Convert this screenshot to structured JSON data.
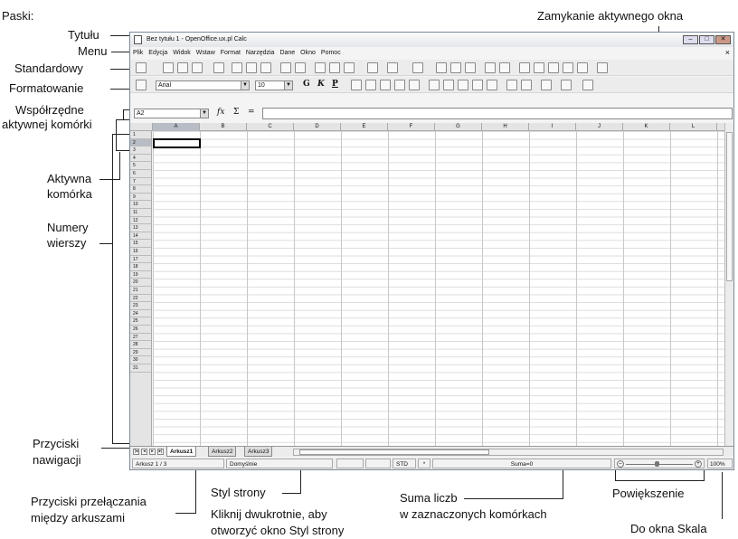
{
  "annotations": {
    "paski": "Paski:",
    "tytulu": "Tytułu",
    "menu": "Menu",
    "standardowy": "Standardowy",
    "formatowanie": "Formatowanie",
    "wspolrzedne_1": "Współrzędne",
    "wspolrzedne_2": "aktywnej komórki",
    "aktywna_1": "Aktywna",
    "aktywna_2": "komórka",
    "numery_1": "Numery",
    "numery_2": "wierszy",
    "nawig_1": "Przyciski",
    "nawig_2": "nawigacji",
    "przel_1": "Przyciski przełączania",
    "przel_2": "między arkuszami",
    "styl_1": "Styl strony",
    "styl_2": "Kliknij dwukrotnie, aby",
    "styl_3": "otworzyć okno Styl strony",
    "suma_1": "Suma liczb",
    "suma_2": "w zaznaczonych komórkach",
    "zamykanie": "Zamykanie aktywnego okna",
    "powiekszenie": "Powiększenie",
    "skala": "Do okna Skala"
  },
  "window": {
    "title": "Bez tytułu 1 - OpenOffice.ux.pl Calc",
    "min_icon": "–",
    "max_icon": "□",
    "close_icon": "✕",
    "menu_close": "×",
    "menu": [
      "Plik",
      "Edycja",
      "Widok",
      "Wstaw",
      "Format",
      "Narzędzia",
      "Dane",
      "Okno",
      "Pomoc"
    ]
  },
  "formatting": {
    "font_name": "Arial",
    "font_size": "10",
    "bold": "G",
    "italic": "K",
    "underline": "P"
  },
  "formula_bar": {
    "cell_ref": "A2",
    "fx": "fx",
    "sum": "Σ",
    "equals": "="
  },
  "columns": [
    "A",
    "B",
    "C",
    "D",
    "E",
    "F",
    "G",
    "H",
    "I",
    "J",
    "K",
    "L"
  ],
  "active_column": "A",
  "active_row": 2,
  "row_count": 31,
  "sheets": [
    "Arkusz1",
    "Arkusz2",
    "Arkusz3"
  ],
  "active_sheet": "Arkusz1",
  "status": {
    "sheet_pos": "Arkusz 1 / 3",
    "page_style": "Domyślnie",
    "mode": "STD",
    "modified": "*",
    "sum": "Suma=0",
    "zoom": "100%"
  }
}
